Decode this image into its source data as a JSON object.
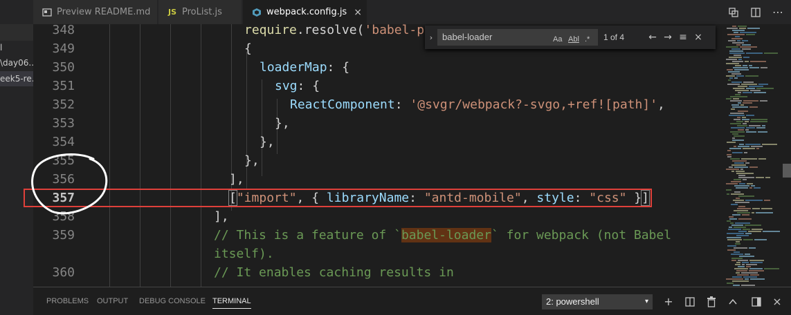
{
  "sidebar": {
    "items": [
      {
        "label": "l"
      },
      {
        "label": "\\day06..."
      },
      {
        "label": "eek5-re..."
      }
    ]
  },
  "tabs": [
    {
      "label": "Preview README.md",
      "icon": "preview-icon"
    },
    {
      "label": "ProList.js",
      "icon": "js-icon",
      "badge": "JS"
    },
    {
      "label": "webpack.config.js",
      "icon": "webpack-icon",
      "close": "×"
    }
  ],
  "editor": {
    "lines": [
      {
        "num": "348"
      },
      {
        "num": "349"
      },
      {
        "num": "350"
      },
      {
        "num": "351"
      },
      {
        "num": "352"
      },
      {
        "num": "353"
      },
      {
        "num": "354"
      },
      {
        "num": "355"
      },
      {
        "num": "356"
      },
      {
        "num": "357"
      },
      {
        "num": "358"
      },
      {
        "num": "359"
      },
      {
        "num": ""
      },
      {
        "num": "360"
      }
    ],
    "code": {
      "l348_fn": "require",
      "l348_rest": ".resolve(",
      "l348_str": "'babel-p",
      "l349": "{",
      "l350_prop": "loaderMap",
      "l350_rest": ": {",
      "l351_prop": "svg",
      "l351_rest": ": {",
      "l352_prop": "ReactComponent",
      "l352_colon": ": ",
      "l352_str": "'@svgr/webpack?-svgo,+ref![path]'",
      "l352_end": ",",
      "l353": "},",
      "l354": "},",
      "l355": "},",
      "l356": "],",
      "l357_open": "[",
      "l357_s1": "\"import\"",
      "l357_p1": ", { ",
      "l357_prop1": "libraryName",
      "l357_p2": ": ",
      "l357_s2": "\"antd-mobile\"",
      "l357_p3": ", ",
      "l357_prop2": "style",
      "l357_p4": ": ",
      "l357_s3": "\"css\"",
      "l357_p5": " }",
      "l357_close": "]",
      "l358": "],",
      "l359_a": "// This is a feature of `",
      "l359_hl": "babel-loader",
      "l359_b": "` for webpack (not Babel",
      "l359_c": "itself).",
      "l360": "// It enables caching results in"
    }
  },
  "find": {
    "query": "babel-loader",
    "match_case": "Aa",
    "whole_word": "Abl",
    "regex": ".*",
    "count": "1 of 4",
    "prev": "←",
    "next": "→",
    "selection": "≡",
    "close": "×",
    "toggle": "›"
  },
  "panel": {
    "tabs": [
      "PROBLEMS",
      "OUTPUT",
      "DEBUG CONSOLE",
      "TERMINAL"
    ],
    "active_tab": "TERMINAL",
    "terminal_select": "2: powershell",
    "terminal_select_caret": "▾",
    "icons": {
      "add": "+",
      "split": "◫",
      "trash": "🗑",
      "maximize": "⌃",
      "layout": "◧",
      "close": "×"
    }
  },
  "colors": {
    "accent": "#e0403a",
    "highlight": "#613214",
    "string": "#ce9178",
    "property": "#9cdcfe",
    "function": "#dcdcaa",
    "comment": "#6a9955"
  }
}
